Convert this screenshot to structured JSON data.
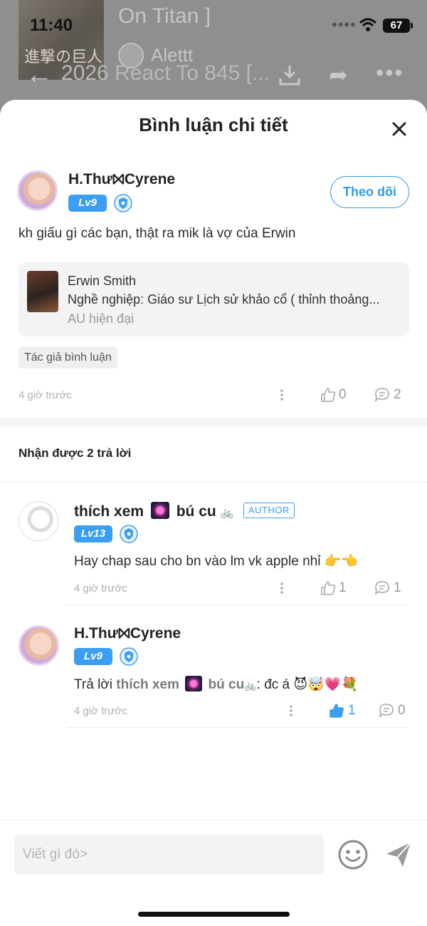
{
  "status_bar": {
    "time": "11:40",
    "battery": "67"
  },
  "background": {
    "thumb_text": "進撃の巨人",
    "title_line1": "On Titan ]",
    "title_line2": "2026 React To 845 [...",
    "author": "Alettt"
  },
  "sheet": {
    "title": "Bình luận chi tiết"
  },
  "comment": {
    "user": "H.Thư⨝Cyrene",
    "level": "Lv9",
    "follow_label": "Theo dõi",
    "text": "kh giấu gì các bạn, thật ra mik là vợ của Erwin",
    "reference": {
      "name": "Erwin Smith",
      "description": "Nghề nghiệp:  Giáo sư Lịch sử khảo cổ ( thỉnh thoảng...",
      "subtitle": "AU hiện đại"
    },
    "tag": "Tác giả bình luận",
    "time": "4 giờ trước",
    "likes": "0",
    "replies": "2"
  },
  "replies_section": {
    "title": "Nhận được 2 trả lời",
    "items": [
      {
        "user_part1": "thích xem",
        "user_part2": "bú cu",
        "level": "Lv13",
        "badge": "AUTHOR",
        "text": "Hay chap sau cho bn vào lm vk apple nhỉ 👉👈",
        "time": "4 giờ trước",
        "likes": "1",
        "replies": "1"
      },
      {
        "user": "H.Thư⨝Cyrene",
        "level": "Lv9",
        "prefix": "Trả lời",
        "mention_part1": "thích xem",
        "mention_part2": "bú cu",
        "suffix": ": đc á",
        "emojis": [
          "😈",
          "🤯",
          "💗",
          "💐"
        ],
        "time": "4 giờ trước",
        "likes": "1",
        "replies": "0"
      }
    ]
  },
  "input": {
    "placeholder": "Viết gì đó>"
  },
  "colors": {
    "accent": "#3b9ef2",
    "muted": "#999999"
  }
}
